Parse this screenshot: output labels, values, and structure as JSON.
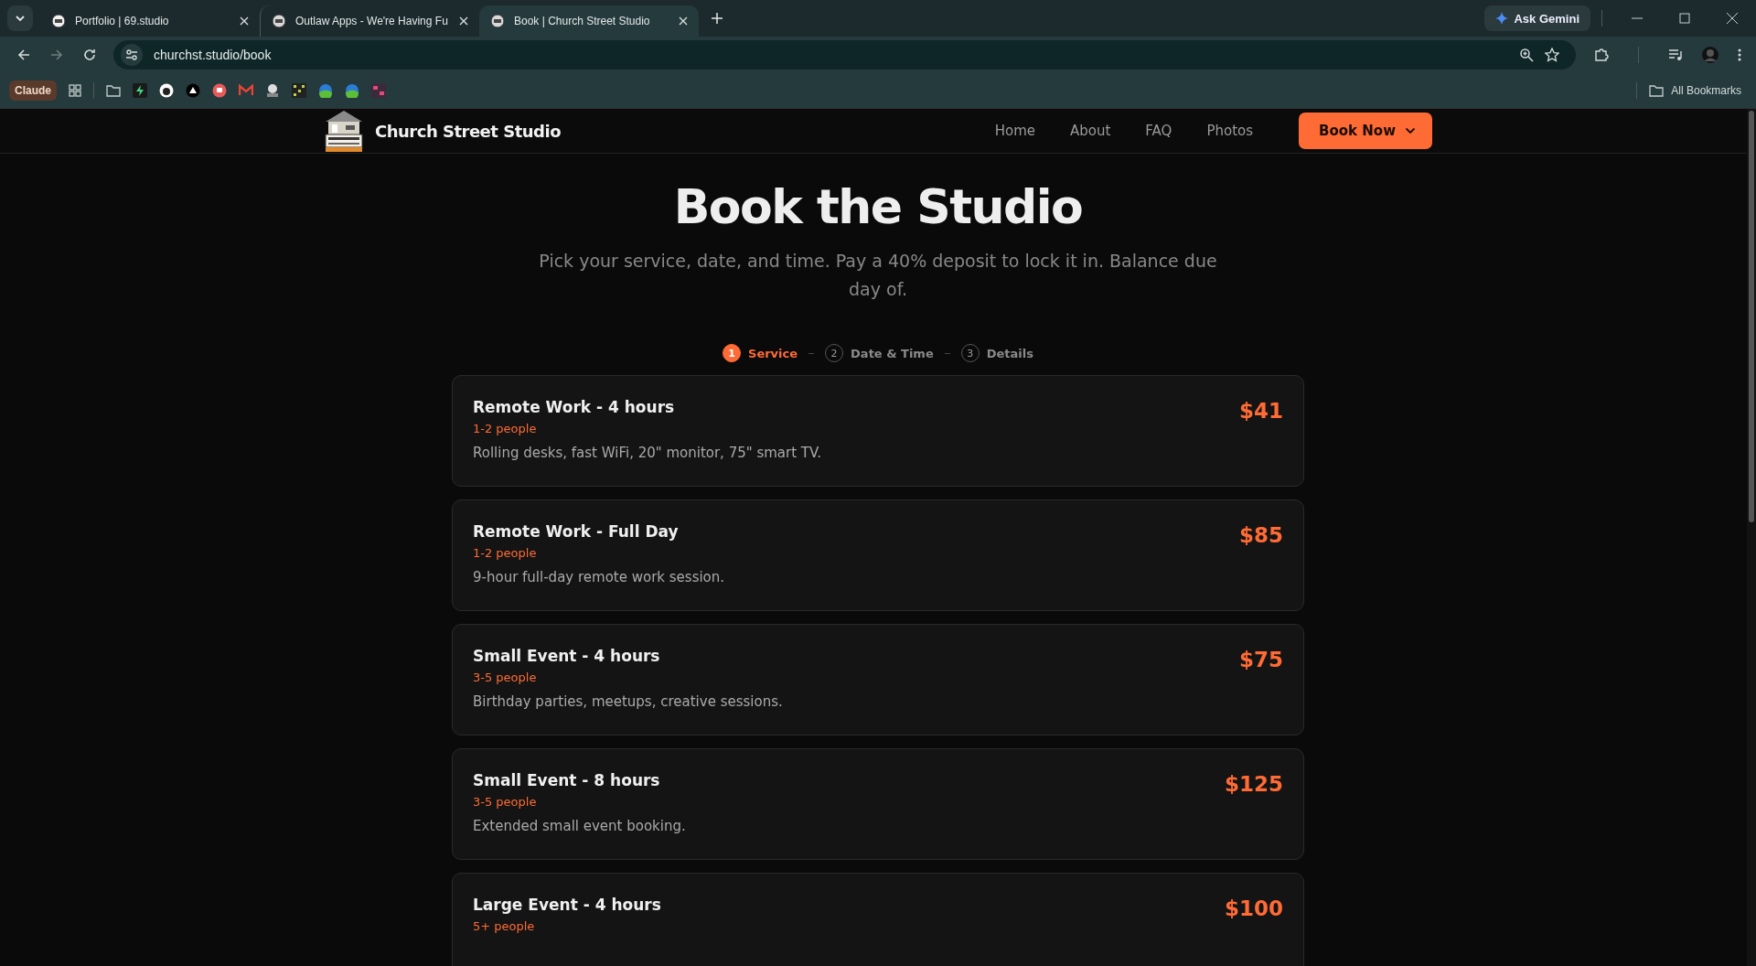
{
  "browser": {
    "tabs": [
      {
        "title": "Portfolio | 69.studio",
        "selected": false
      },
      {
        "title": "Outlaw Apps - We're Having Fu",
        "selected": false
      },
      {
        "title": "Book | Church Street Studio",
        "selected": true
      }
    ],
    "ask_button": "Ask Gemini",
    "address": "churchst.studio/book",
    "bookmarks": {
      "chip": "Claude",
      "folder": "All Bookmarks"
    }
  },
  "site": {
    "brand": "Church Street Studio",
    "nav": [
      "Home",
      "About",
      "FAQ",
      "Photos"
    ],
    "cta": "Book Now"
  },
  "hero": {
    "title": "Book the Studio",
    "subtitle": "Pick your service, date, and time. Pay a 40% deposit to lock it in. Balance due day of."
  },
  "steps": [
    {
      "number": "1",
      "label": "Service",
      "selected": true
    },
    {
      "number": "2",
      "label": "Date & Time",
      "selected": false
    },
    {
      "number": "3",
      "label": "Details",
      "selected": false
    }
  ],
  "services": [
    {
      "name": "Remote Work - 4 hours",
      "people": "1-2 people",
      "description": "Rolling desks, fast WiFi, 20\" monitor, 75\" smart TV.",
      "price": "$41"
    },
    {
      "name": "Remote Work - Full Day",
      "people": "1-2 people",
      "description": "9-hour full-day remote work session.",
      "price": "$85"
    },
    {
      "name": "Small Event - 4 hours",
      "people": "3-5 people",
      "description": "Birthday parties, meetups, creative sessions.",
      "price": "$75"
    },
    {
      "name": "Small Event - 8 hours",
      "people": "3-5 people",
      "description": "Extended small event booking.",
      "price": "$125"
    },
    {
      "name": "Large Event - 4 hours",
      "people": "5+ people",
      "price": "$100"
    }
  ]
}
